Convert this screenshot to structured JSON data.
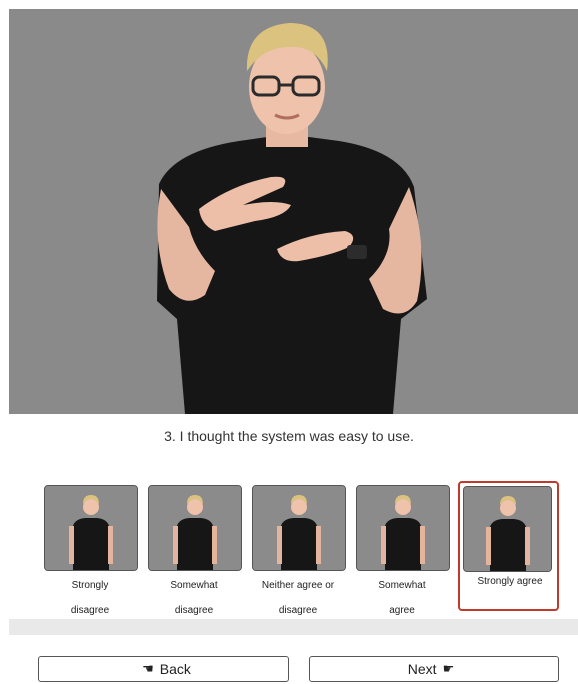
{
  "question": {
    "text": "3. I thought the system was easy to use."
  },
  "options": [
    {
      "line1": "Strongly",
      "line2": "disagree"
    },
    {
      "line1": "Somewhat",
      "line2": "disagree"
    },
    {
      "line1": "Neither agree or",
      "line2": "disagree"
    },
    {
      "line1": "Somewhat",
      "line2": "agree"
    },
    {
      "line1": "Strongly agree",
      "line2": "",
      "selected": true
    }
  ],
  "nav": {
    "back_label": "Back",
    "next_label": "Next",
    "back_icon": "hand-pointing-left-icon",
    "next_icon": "hand-pointing-right-icon"
  },
  "colors": {
    "video_background": "#8a8a8a",
    "selected_border": "#c0392b",
    "progress_track": "#e9e9e9"
  }
}
